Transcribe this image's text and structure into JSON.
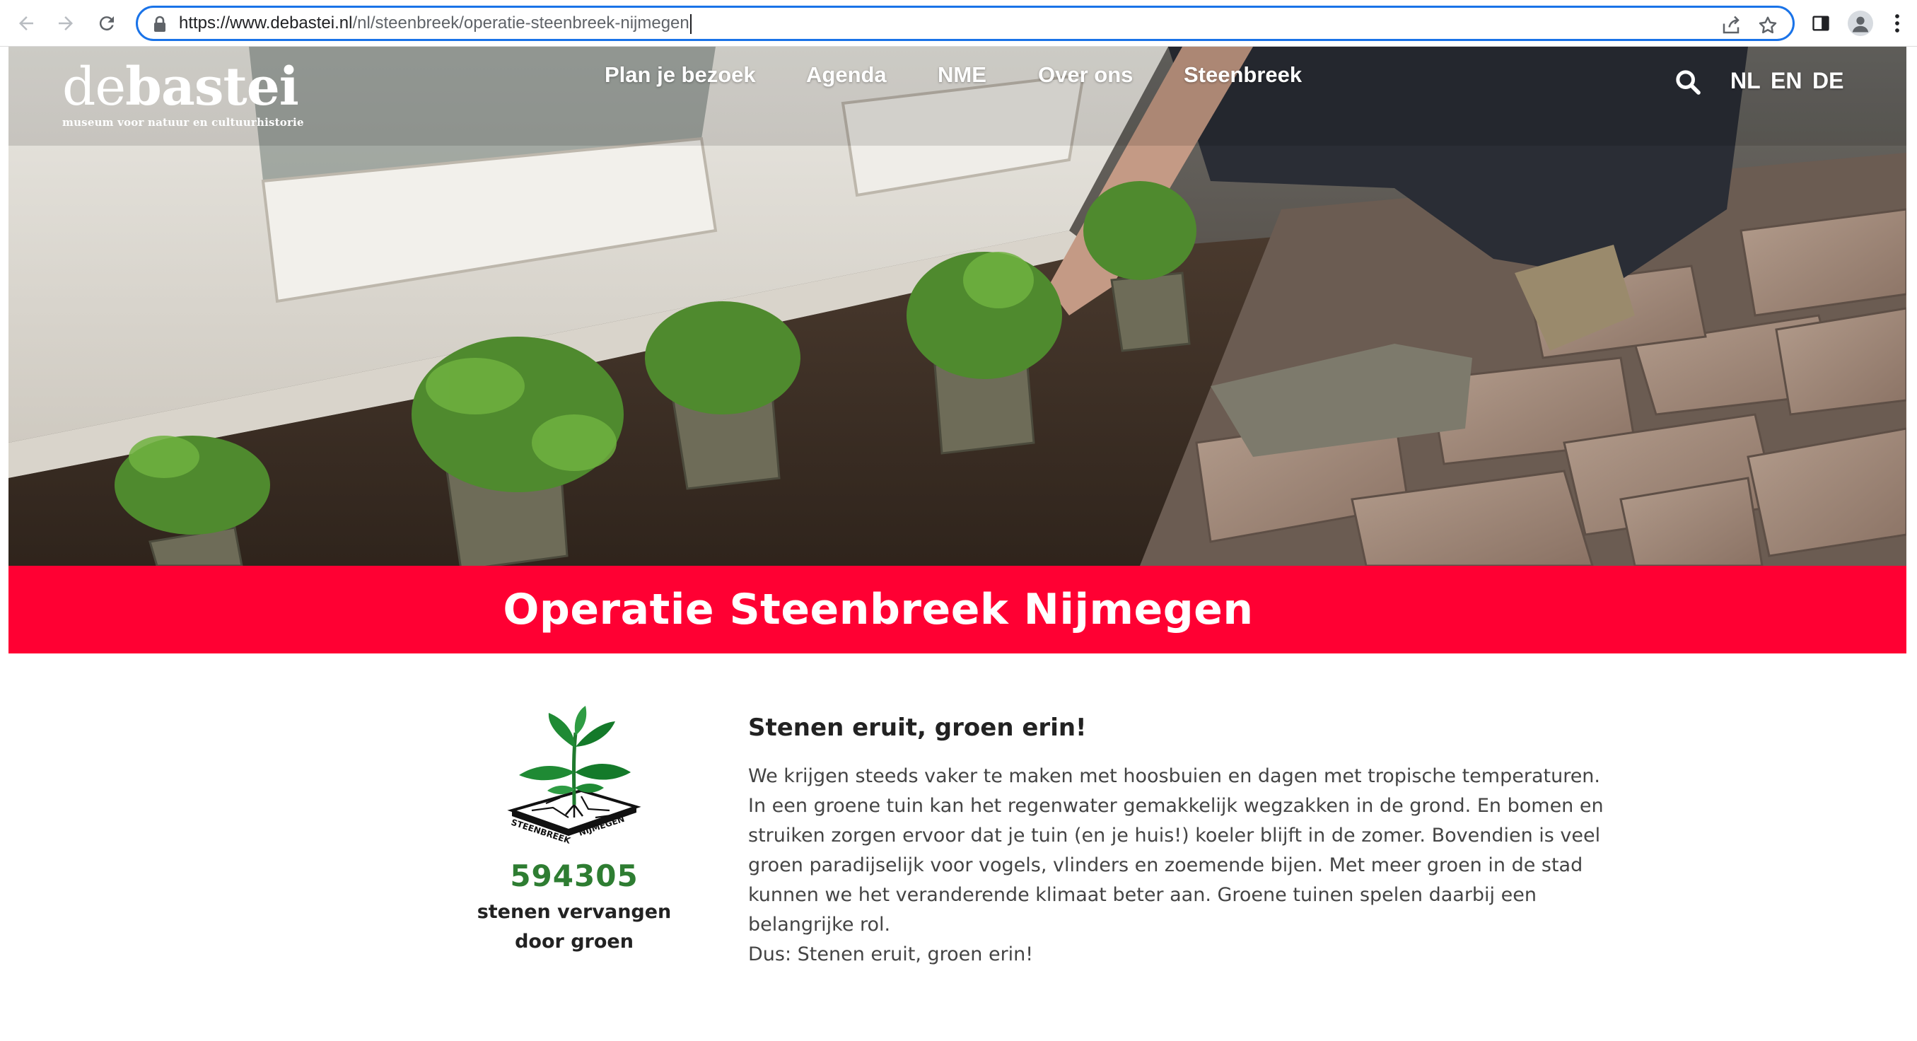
{
  "browser": {
    "url_main": "https://www.debastei.nl",
    "url_path": "/nl/steenbreek/operatie-steenbreek-nijmegen",
    "icons": [
      "back-icon",
      "forward-icon",
      "reload-icon",
      "lock-icon",
      "share-icon",
      "star-icon",
      "side-panel-icon",
      "profile-icon",
      "menu-icon"
    ]
  },
  "site": {
    "logo_de": "de",
    "logo_bastei": "bastei",
    "logo_tagline": "museum voor natuur en cultuurhistorie",
    "nav": [
      "Plan je bezoek",
      "Agenda",
      "NME",
      "Over ons",
      "Steenbreek"
    ],
    "languages": [
      "NL",
      "EN",
      "DE"
    ]
  },
  "banner": {
    "title": "Operatie Steenbreek Nijmegen",
    "color": "#ff0033"
  },
  "counter": {
    "logo_text_left": "STEENBREEK",
    "logo_text_right": "NIJMEGEN",
    "value": "594305",
    "label_line1": "stenen vervangen",
    "label_line2": "door groen"
  },
  "article": {
    "heading": "Stenen eruit, groen erin!",
    "body": "We krijgen steeds vaker te maken met hoosbuien en dagen met tropische temperaturen. In een groene tuin kan het regenwater gemakkelijk wegzakken in de grond. En bomen en struiken zorgen ervoor dat je tuin (en je huis!) koeler blijft in de zomer. Bovendien is veel groen paradijselijk voor vogels, vlinders en zoemende bijen. Met meer groen in de stad kunnen we het veranderende klimaat beter aan. Groene tuinen spelen daarbij een belangrijke rol.",
    "closing": "Dus: Stenen eruit, groen erin!"
  }
}
